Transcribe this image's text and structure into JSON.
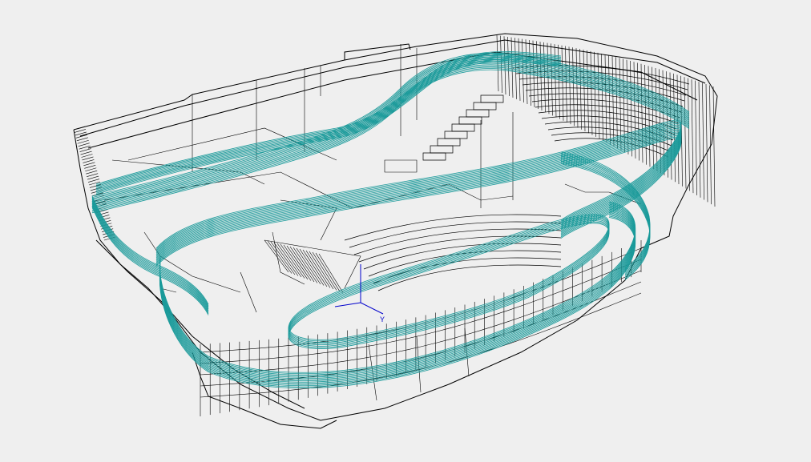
{
  "viewport": {
    "background_color": "#efefef",
    "wire_color": "#000000",
    "ramp_color": "#1a9a9a",
    "axis_x_color": "#0000cc",
    "axis_y_color": "#0000cc"
  },
  "axes": {
    "y_label": "Y"
  }
}
